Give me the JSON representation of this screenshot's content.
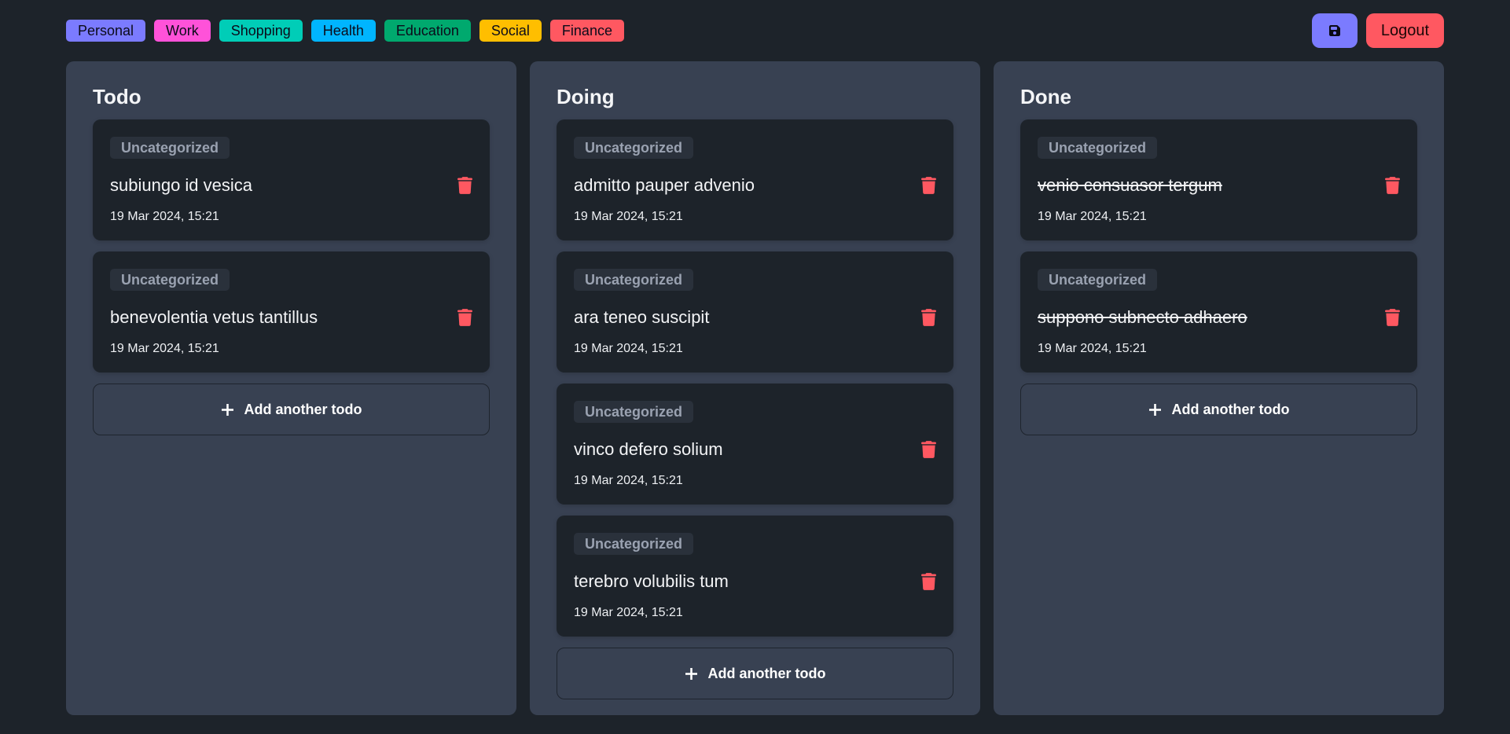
{
  "categories": [
    {
      "label": "Personal",
      "color": "#7b7bff"
    },
    {
      "label": "Work",
      "color": "#ff52d9"
    },
    {
      "label": "Shopping",
      "color": "#00cdb7"
    },
    {
      "label": "Health",
      "color": "#00b5ff"
    },
    {
      "label": "Education",
      "color": "#00a96e"
    },
    {
      "label": "Social",
      "color": "#ffbe00"
    },
    {
      "label": "Finance",
      "color": "#ff5861"
    }
  ],
  "header": {
    "save_icon": "floppy-disk-icon",
    "logout_label": "Logout"
  },
  "icons": {
    "delete": "trash-icon",
    "add": "plus-icon"
  },
  "columns": [
    {
      "title": "Todo",
      "add_label": "Add another todo",
      "items": [
        {
          "category": "Uncategorized",
          "title": "subiungo id vesica",
          "date": "19 Mar 2024, 15:21",
          "done": false
        },
        {
          "category": "Uncategorized",
          "title": "benevolentia vetus tantillus",
          "date": "19 Mar 2024, 15:21",
          "done": false
        }
      ]
    },
    {
      "title": "Doing",
      "add_label": "Add another todo",
      "items": [
        {
          "category": "Uncategorized",
          "title": "admitto pauper advenio",
          "date": "19 Mar 2024, 15:21",
          "done": false
        },
        {
          "category": "Uncategorized",
          "title": "ara teneo suscipit",
          "date": "19 Mar 2024, 15:21",
          "done": false
        },
        {
          "category": "Uncategorized",
          "title": "vinco defero solium",
          "date": "19 Mar 2024, 15:21",
          "done": false
        },
        {
          "category": "Uncategorized",
          "title": "terebro volubilis tum",
          "date": "19 Mar 2024, 15:21",
          "done": false
        }
      ]
    },
    {
      "title": "Done",
      "add_label": "Add another todo",
      "items": [
        {
          "category": "Uncategorized",
          "title": "venio consuasor tergum",
          "date": "19 Mar 2024, 15:21",
          "done": true
        },
        {
          "category": "Uncategorized",
          "title": "suppono subnecto adhaero",
          "date": "19 Mar 2024, 15:21",
          "done": true
        }
      ]
    }
  ]
}
